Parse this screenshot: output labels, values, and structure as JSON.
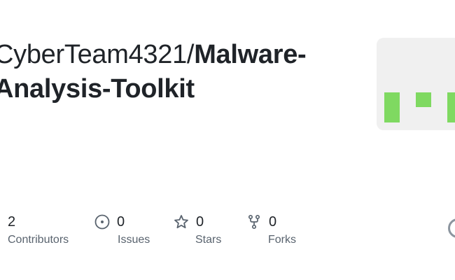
{
  "repo": {
    "owner": "CyberTeam4321/",
    "name_part1": "Malware-",
    "name_part2": "Analysis-Toolkit"
  },
  "stats": [
    {
      "icon": "people-icon",
      "value": "2",
      "label": "Contributors"
    },
    {
      "icon": "issue-opened-icon",
      "value": "0",
      "label": "Issues"
    },
    {
      "icon": "star-icon",
      "value": "0",
      "label": "Stars"
    },
    {
      "icon": "repo-forked-icon",
      "value": "0",
      "label": "Forks"
    }
  ],
  "colors": {
    "text": "#1f2328",
    "muted": "#59636e",
    "avatar_bg": "#f0f0f0",
    "avatar_pixel": "#7fd961",
    "icon": "#59636e"
  }
}
